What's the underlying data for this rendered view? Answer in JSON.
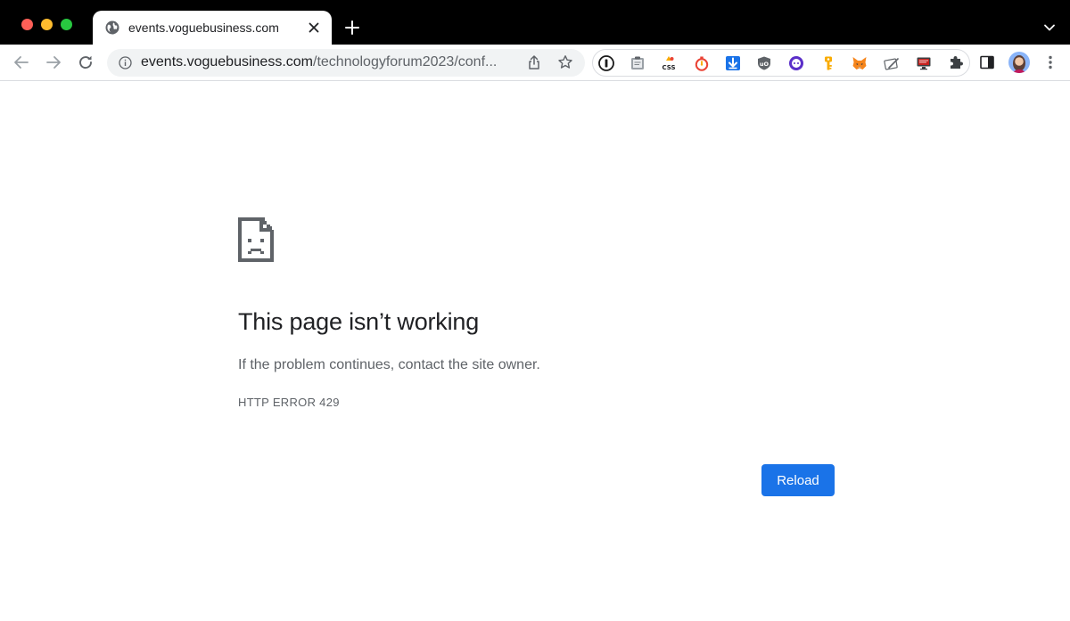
{
  "tab": {
    "title": "events.voguebusiness.com",
    "favicon": "globe-icon"
  },
  "omnibox": {
    "host": "events.voguebusiness.com",
    "path": "/technologyforum2023/conf..."
  },
  "extensions": [
    "1password-icon",
    "clipboard-icon",
    "css-peeper-icon",
    "stopwatch-icon",
    "download-icon",
    "ublock-icon",
    "chat-bubble-icon",
    "key-icon",
    "metamask-fox-icon",
    "note-pencil-icon",
    "monitor-icon"
  ],
  "error": {
    "title": "This page isn’t working",
    "description": "If the problem continues, contact the site owner.",
    "code": "HTTP ERROR 429",
    "reload_label": "Reload"
  },
  "colors": {
    "tabstrip": "#000000",
    "accent": "#1a73e8",
    "traffic_close": "#fe5f57",
    "traffic_minimize": "#febc2e",
    "traffic_maximize": "#28c840"
  }
}
